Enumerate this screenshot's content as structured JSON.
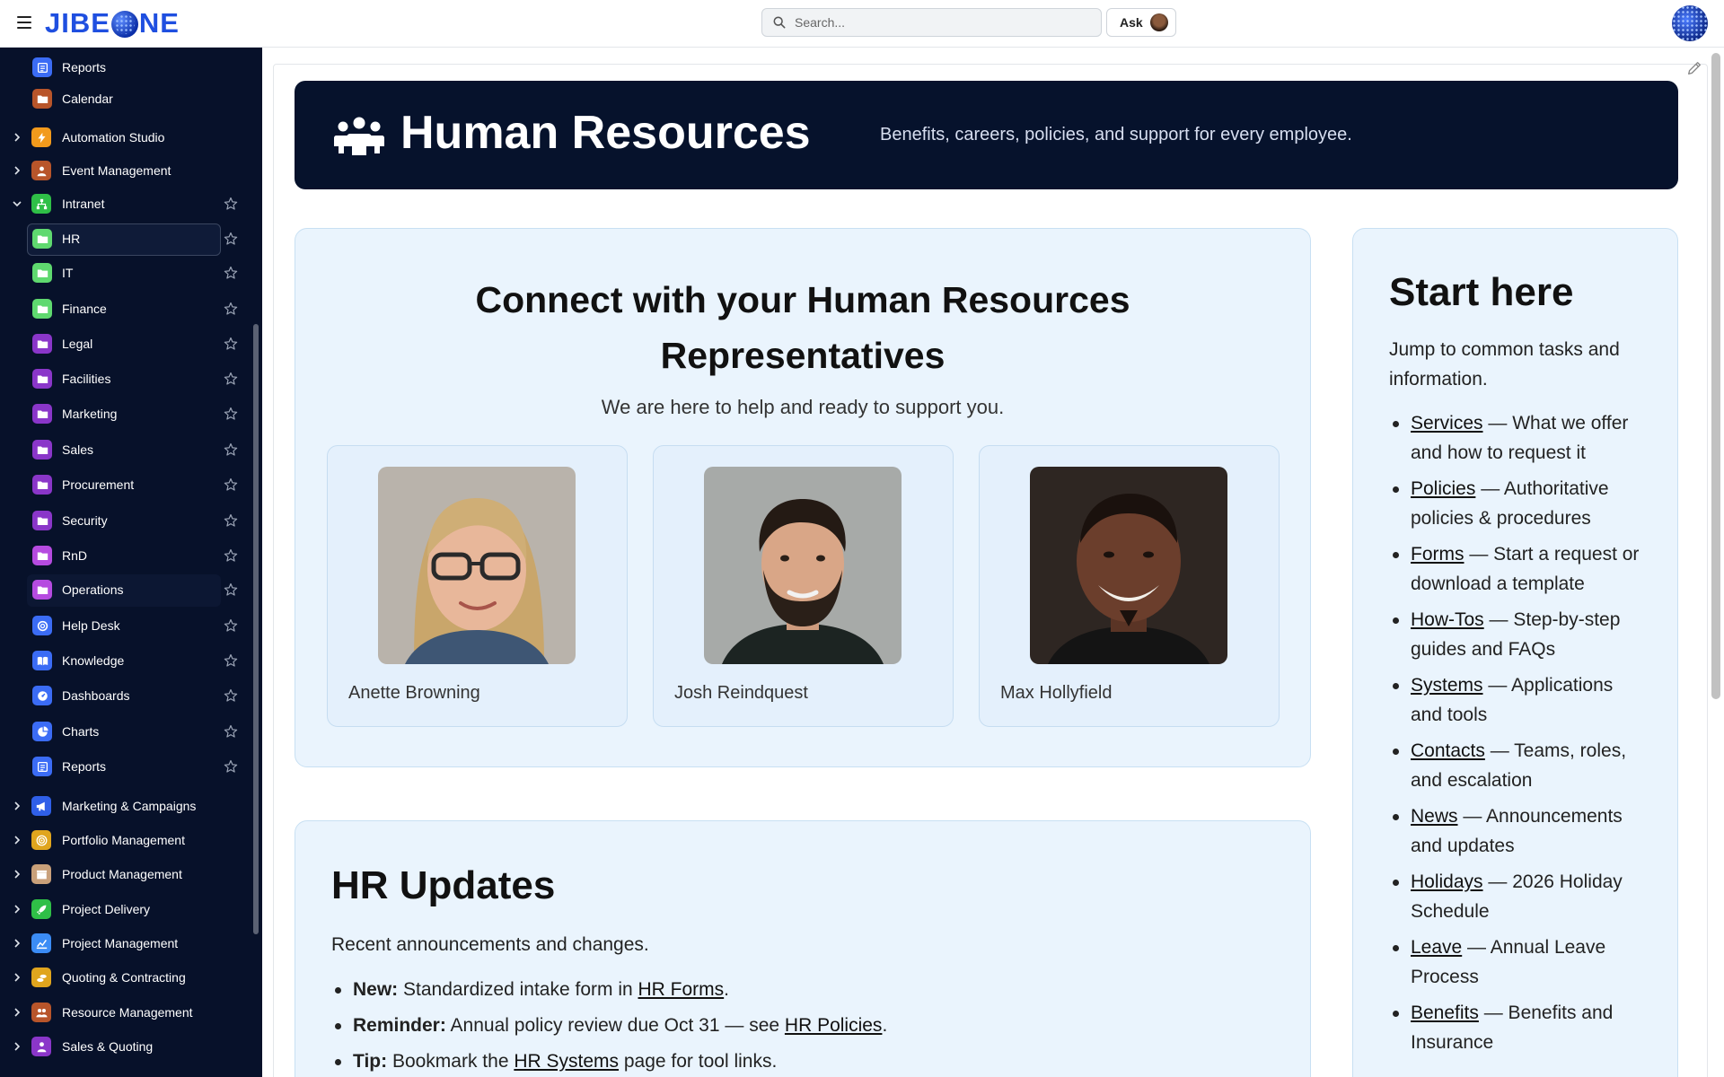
{
  "header": {
    "logo_text_left": "JIBE",
    "logo_text_right": "NE",
    "search_placeholder": "Search...",
    "ask_label": "Ask"
  },
  "sidebar": {
    "items": [
      {
        "label": "Reports",
        "color": "#3b6cf5",
        "icon": "report-icon",
        "level": 2,
        "star": false
      },
      {
        "label": "Calendar",
        "color": "#b8552a",
        "icon": "folder-icon",
        "level": 2,
        "star": false
      },
      {
        "label": "Automation Studio",
        "color": "#f29a1c",
        "icon": "bolt-icon",
        "level": 1,
        "star": false,
        "chevron": "right"
      },
      {
        "label": "Event Management",
        "color": "#b8552a",
        "icon": "person-icon",
        "level": 1,
        "star": false,
        "chevron": "right"
      },
      {
        "label": "Intranet",
        "color": "#2fbf47",
        "icon": "org-icon",
        "level": 1,
        "star": true,
        "chevron": "down"
      },
      {
        "label": "HR",
        "color": "#5fd96f",
        "icon": "folder-icon",
        "level": 2,
        "star": true,
        "active": true
      },
      {
        "label": "IT",
        "color": "#5fd96f",
        "icon": "folder-icon",
        "level": 2,
        "star": true
      },
      {
        "label": "Finance",
        "color": "#5fd96f",
        "icon": "folder-icon",
        "level": 2,
        "star": true
      },
      {
        "label": "Legal",
        "color": "#8a36c9",
        "icon": "folder-icon",
        "level": 2,
        "star": true
      },
      {
        "label": "Facilities",
        "color": "#8a36c9",
        "icon": "folder-icon",
        "level": 2,
        "star": true
      },
      {
        "label": "Marketing",
        "color": "#8a36c9",
        "icon": "folder-icon",
        "level": 2,
        "star": true
      },
      {
        "label": "Sales",
        "color": "#8a36c9",
        "icon": "folder-icon",
        "level": 2,
        "star": true
      },
      {
        "label": "Procurement",
        "color": "#8a36c9",
        "icon": "folder-icon",
        "level": 2,
        "star": true
      },
      {
        "label": "Security",
        "color": "#8a36c9",
        "icon": "folder-icon",
        "level": 2,
        "star": true
      },
      {
        "label": "RnD",
        "color": "#b64be0",
        "icon": "folder-icon",
        "level": 2,
        "star": true
      },
      {
        "label": "Operations",
        "color": "#b64be0",
        "icon": "folder-icon",
        "level": 2,
        "star": true,
        "hover": true
      },
      {
        "label": "Help Desk",
        "color": "#3b6cf5",
        "icon": "lifebuoy-icon",
        "level": 2,
        "star": true
      },
      {
        "label": "Knowledge",
        "color": "#3b6cf5",
        "icon": "book-icon",
        "level": 2,
        "star": true
      },
      {
        "label": "Dashboards",
        "color": "#3b6cf5",
        "icon": "gauge-icon",
        "level": 2,
        "star": true
      },
      {
        "label": "Charts",
        "color": "#3b6cf5",
        "icon": "pie-icon",
        "level": 2,
        "star": true
      },
      {
        "label": "Reports",
        "color": "#3b6cf5",
        "icon": "report-icon",
        "level": 2,
        "star": true
      },
      {
        "label": "Marketing & Campaigns",
        "color": "#2f5fe8",
        "icon": "megaphone-icon",
        "level": 1,
        "star": false,
        "chevron": "right"
      },
      {
        "label": "Portfolio Management",
        "color": "#e0a51e",
        "icon": "target-icon",
        "level": 1,
        "star": false,
        "chevron": "right"
      },
      {
        "label": "Product Management",
        "color": "#c9a07a",
        "icon": "box-icon",
        "level": 1,
        "star": false,
        "chevron": "right"
      },
      {
        "label": "Project Delivery",
        "color": "#2fbf47",
        "icon": "rocket-icon",
        "level": 1,
        "star": false,
        "chevron": "right"
      },
      {
        "label": "Project Management",
        "color": "#3b8cf5",
        "icon": "chart-icon",
        "level": 1,
        "star": false,
        "chevron": "right"
      },
      {
        "label": "Quoting & Contracting",
        "color": "#e0a51e",
        "icon": "coins-icon",
        "level": 1,
        "star": false,
        "chevron": "right"
      },
      {
        "label": "Resource Management",
        "color": "#b8552a",
        "icon": "people-icon",
        "level": 1,
        "star": false,
        "chevron": "right"
      },
      {
        "label": "Sales & Quoting",
        "color": "#8a36c9",
        "icon": "dollar-person-icon",
        "level": 1,
        "star": false,
        "chevron": "right"
      }
    ]
  },
  "hero": {
    "title": "Human Resources",
    "tagline": "Benefits, careers, policies, and support for every employee."
  },
  "reps": {
    "title_line1": "Connect with your Human Resources",
    "title_line2": "Representatives",
    "subtitle": "We are here to help and ready to support you.",
    "people": [
      {
        "name": "Anette Browning"
      },
      {
        "name": "Josh Reindquest"
      },
      {
        "name": "Max Hollyfield"
      }
    ]
  },
  "start": {
    "title": "Start here",
    "intro": "Jump to common tasks and information.",
    "links": [
      {
        "link": "Services",
        "desc": " — What we offer and how to request it"
      },
      {
        "link": "Policies",
        "desc": " — Authoritative policies & procedures"
      },
      {
        "link": "Forms",
        "desc": " — Start a request or download a template"
      },
      {
        "link": "How-Tos",
        "desc": " — Step-by-step guides and FAQs"
      },
      {
        "link": "Systems",
        "desc": " — Applications and tools"
      },
      {
        "link": "Contacts",
        "desc": " — Teams, roles, and escalation"
      },
      {
        "link": "News",
        "desc": " — Announcements and updates"
      },
      {
        "link": "Holidays",
        "desc": " — 2026 Holiday Schedule"
      },
      {
        "link": "Leave",
        "desc": " — Annual Leave Process"
      },
      {
        "link": "Benefits",
        "desc": " — Benefits and Insurance"
      }
    ]
  },
  "updates": {
    "title": "HR Updates",
    "subtitle": "Recent announcements and changes.",
    "items": [
      {
        "label": "New:",
        "pre": " Standardized intake form in ",
        "link": "HR Forms",
        "post": "."
      },
      {
        "label": "Reminder:",
        "pre": " Annual policy review due Oct 31 — see ",
        "link": "HR Policies",
        "post": "."
      },
      {
        "label": "Tip:",
        "pre": " Bookmark the ",
        "link": "HR Systems",
        "post": " page for tool links."
      }
    ]
  }
}
